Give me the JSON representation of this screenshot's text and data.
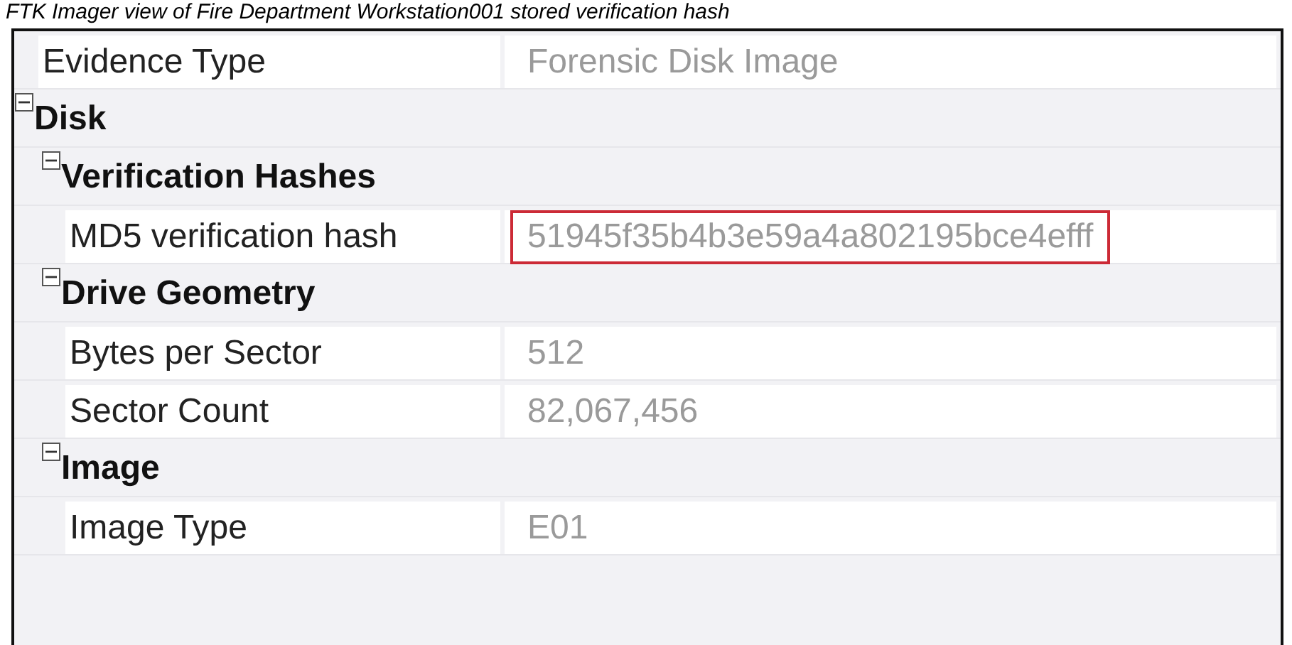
{
  "caption": "FTK Imager view of Fire Department Workstation001 stored verification hash",
  "properties": [
    {
      "kind": "property",
      "label": "Evidence Type",
      "value": "Forensic Disk Image",
      "highlighted": false
    },
    {
      "kind": "category",
      "label": "Disk",
      "expanded": true,
      "children": [
        {
          "kind": "category",
          "label": "Verification Hashes",
          "expanded": true,
          "children": [
            {
              "kind": "property",
              "label": "MD5 verification hash",
              "value": "51945f35b4b3e59a4a802195bce4efff",
              "highlighted": true
            }
          ]
        },
        {
          "kind": "category",
          "label": "Drive Geometry",
          "expanded": true,
          "children": [
            {
              "kind": "property",
              "label": "Bytes per Sector",
              "value": "512",
              "highlighted": false
            },
            {
              "kind": "property",
              "label": "Sector Count",
              "value": "82,067,456",
              "highlighted": false
            }
          ]
        },
        {
          "kind": "category",
          "label": "Image",
          "expanded": true,
          "children": [
            {
              "kind": "property",
              "label": "Image Type",
              "value": "E01",
              "highlighted": false
            }
          ]
        }
      ]
    }
  ]
}
